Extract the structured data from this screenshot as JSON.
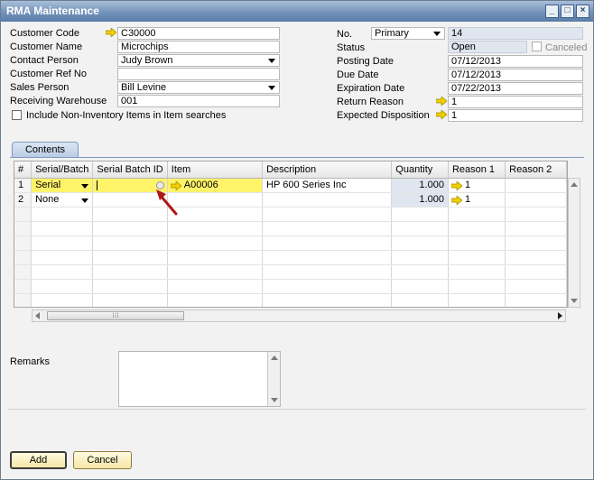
{
  "window": {
    "title": "RMA Maintenance"
  },
  "header_left": {
    "customer_code_label": "Customer Code",
    "customer_code": "C30000",
    "customer_name_label": "Customer Name",
    "customer_name": "Microchips",
    "contact_person_label": "Contact Person",
    "contact_person": "Judy Brown",
    "customer_ref_label": "Customer Ref No",
    "customer_ref": "",
    "sales_person_label": "Sales Person",
    "sales_person": "Bill Levine",
    "warehouse_label": "Receiving Warehouse",
    "warehouse": "001",
    "include_label": "Include Non-Inventory Items in Item searches"
  },
  "header_right": {
    "no_label": "No.",
    "series": "Primary",
    "doc_no": "14",
    "status_label": "Status",
    "status": "Open",
    "canceled_label": "Canceled",
    "posting_label": "Posting Date",
    "posting_date": "07/12/2013",
    "due_label": "Due Date",
    "due_date": "07/12/2013",
    "expiration_label": "Expiration Date",
    "expiration_date": "07/22/2013",
    "return_reason_label": "Return Reason",
    "return_reason": "1",
    "disposition_label": "Expected Disposition",
    "disposition": "1"
  },
  "tabs": {
    "contents": "Contents"
  },
  "grid": {
    "columns": [
      "#",
      "Serial/Batch",
      "Serial Batch ID",
      "Item",
      "Description",
      "Quantity",
      "Reason 1",
      "Reason 2"
    ],
    "rows": [
      {
        "no": "1",
        "serial_batch": "Serial",
        "batch_id": "",
        "item": "A00006",
        "description": "HP 600 Series Inc",
        "quantity": "1.000",
        "reason1": "1",
        "reason2": ""
      },
      {
        "no": "2",
        "serial_batch": "None",
        "batch_id": "",
        "item": "",
        "description": "",
        "quantity": "1.000",
        "reason1": "1",
        "reason2": ""
      }
    ]
  },
  "remarks": {
    "label": "Remarks",
    "value": ""
  },
  "buttons": {
    "add": "Add",
    "cancel": "Cancel"
  },
  "colors": {
    "highlight": "#fff36a",
    "readonly": "#dfe6ef",
    "link_arrow": "#f0d000",
    "pointer": "#b01616"
  }
}
